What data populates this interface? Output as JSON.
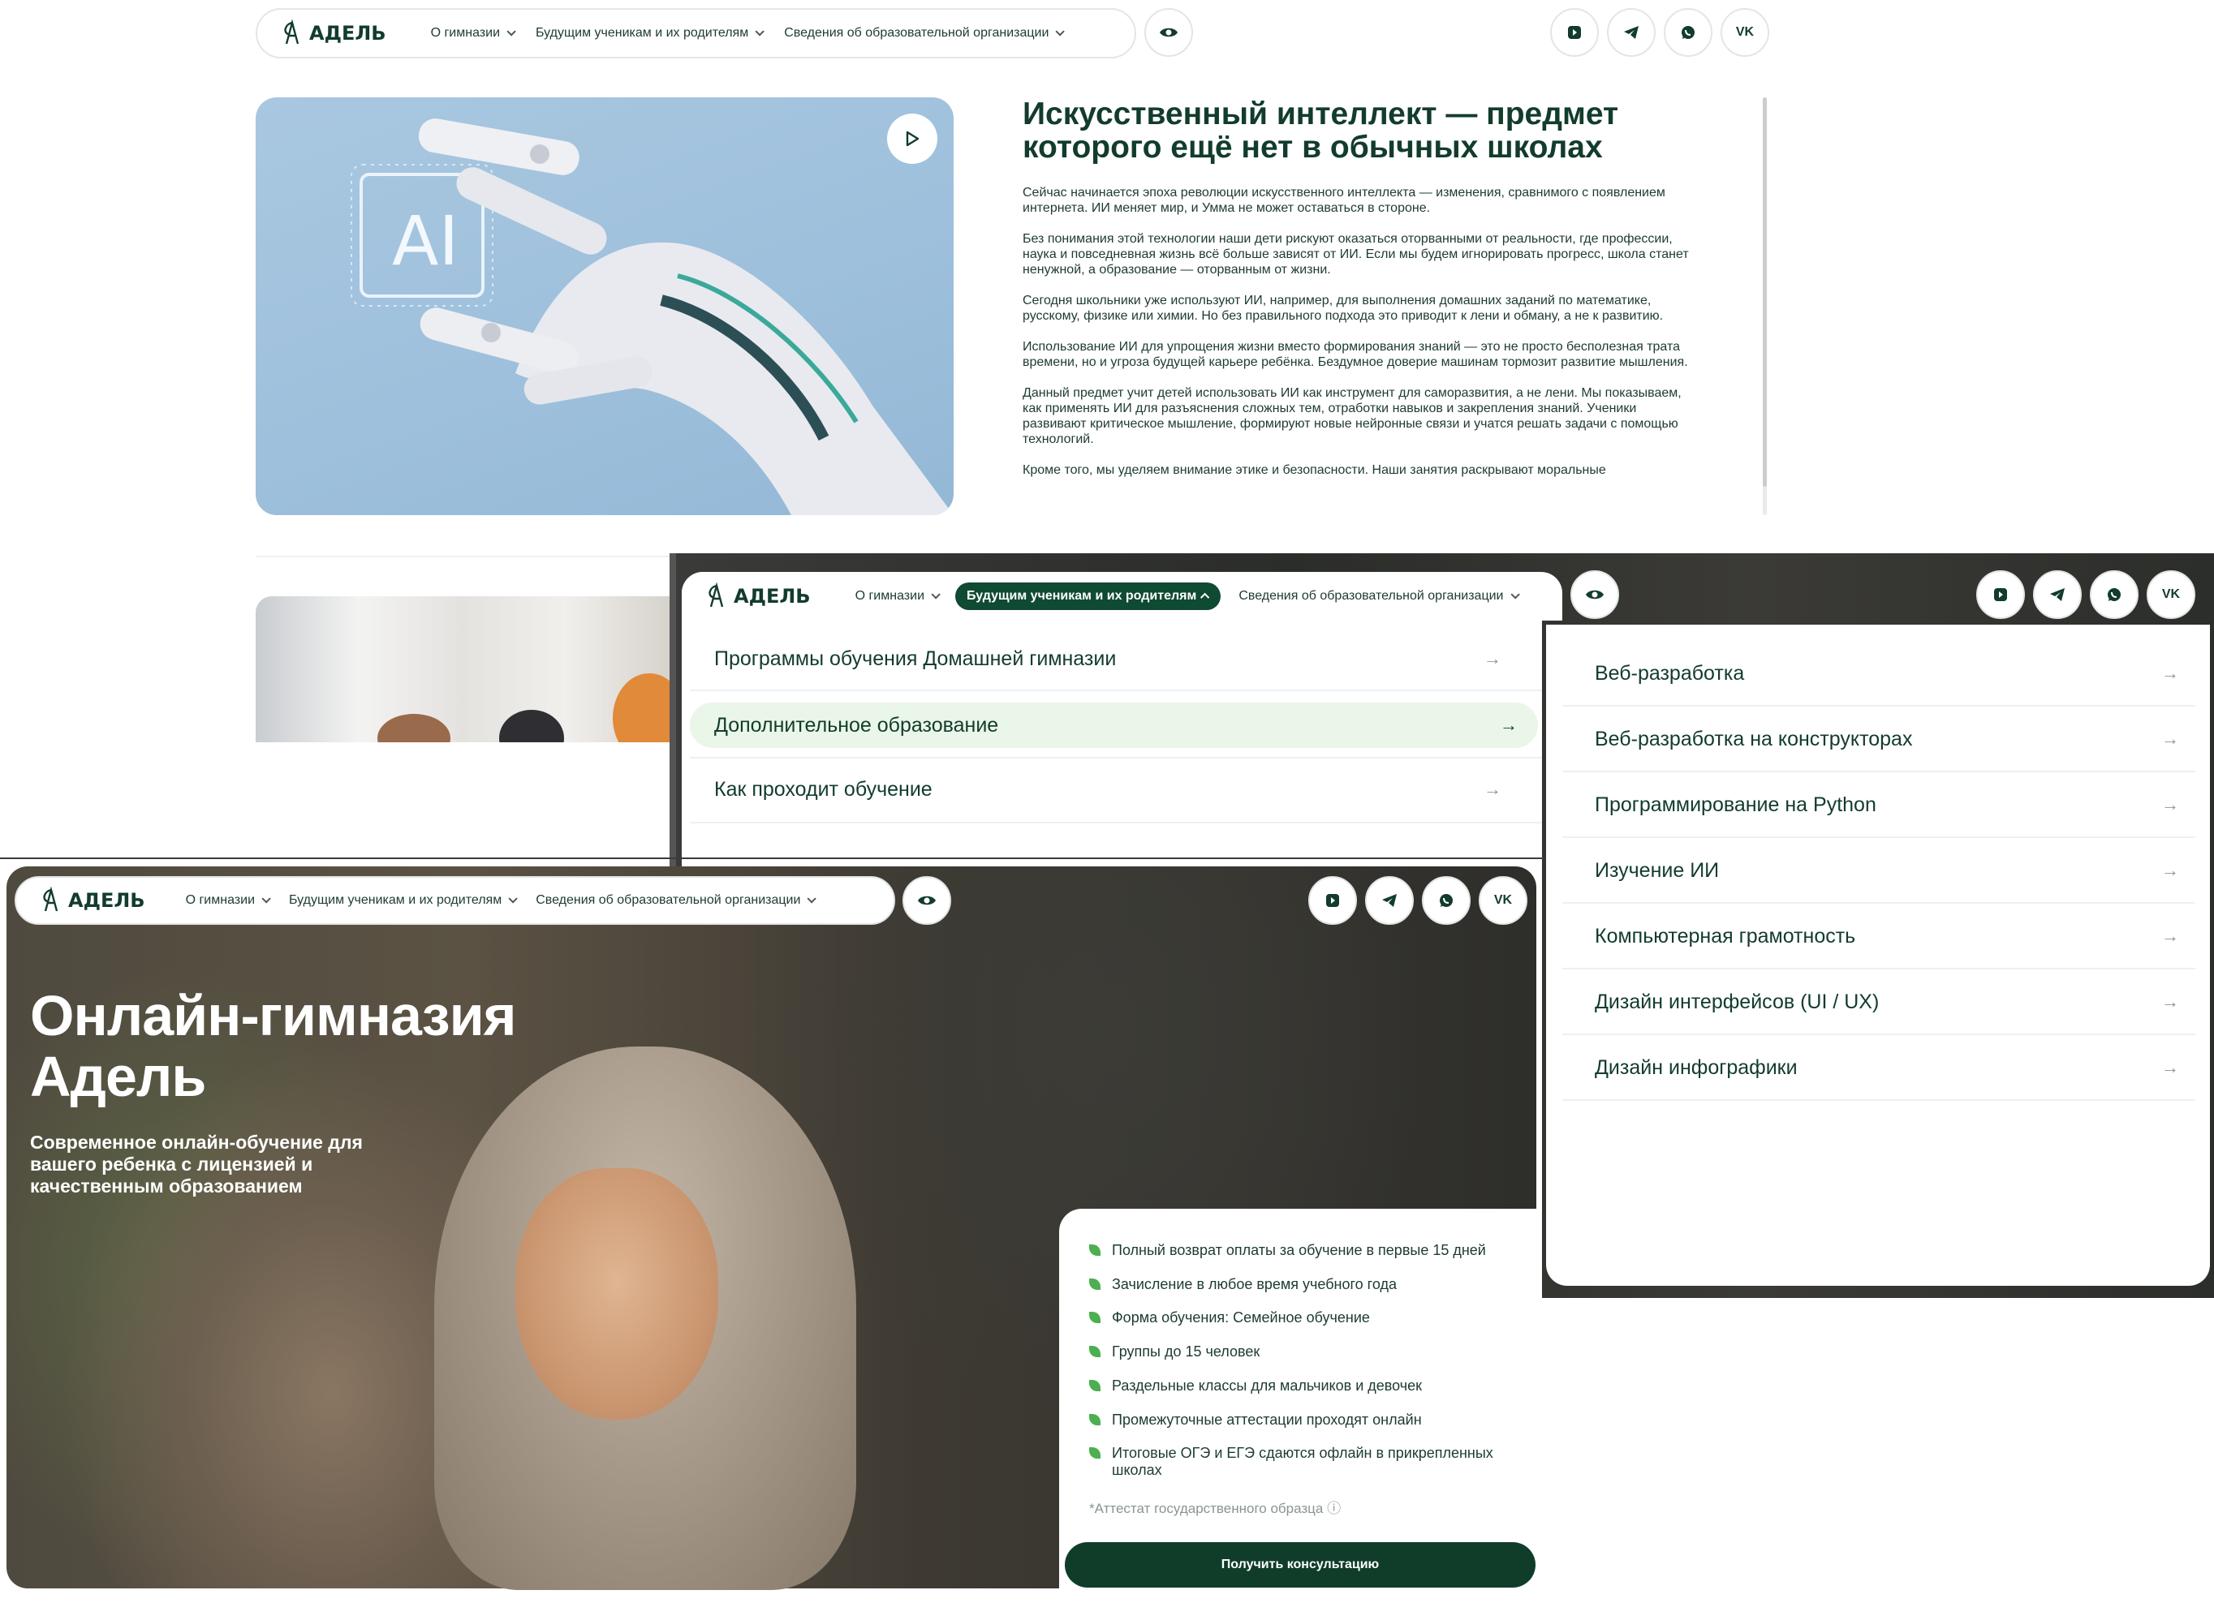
{
  "brand": {
    "logo_text": "АДЕЛЬ"
  },
  "nav": {
    "about": "О гимназии",
    "future": "Будущим ученикам и их родителям",
    "info": "Сведения об образовательной организации"
  },
  "icons": {
    "accessibility": "eye-icon",
    "rutube": "rutube-icon",
    "telegram": "telegram-icon",
    "whatsapp": "whatsapp-icon",
    "vk": "vk-icon",
    "vk_text": "VK"
  },
  "article": {
    "image_text": "AI",
    "title": "Искусственный интеллект — предмет которого ещё нет в обычных школах",
    "paragraphs": [
      "Сейчас начинается эпоха революции искусственного интеллекта — изменения, сравнимого с появлением интернета. ИИ меняет мир, и Умма не может оставаться в стороне.",
      "Без понимания этой технологии наши дети рискуют оказаться оторванными от реальности, где профессии, наука и повседневная жизнь всё больше зависят от ИИ. Если мы будем игнорировать прогресс, школа станет ненужной, а образование — оторванным от жизни.",
      "Сегодня школьники уже используют ИИ, например, для выполнения домашних заданий по математике, русскому, физике или химии. Но без правильного подхода это приводит к лени и обману, а не к развитию.",
      "Использование ИИ для упрощения жизни вместо формирования знаний — это не просто бесполезная трата времени, но и угроза будущей карьере ребёнка. Бездумное доверие машинам тормозит развитие мышления.",
      "Данный предмет учит детей использовать ИИ как инструмент для саморазвития, а не лени. Мы показываем, как применять ИИ для разъяснения сложных тем, отработки навыков и закрепления знаний. Ученики развивают критическое мышление, формируют новые нейронные связи и учатся решать задачи с помощью технологий.",
      "Кроме того, мы уделяем внимание этике и безопасности. Наши занятия раскрывают моральные"
    ]
  },
  "menu": {
    "left": [
      {
        "label": "Программы обучения Домашней гимназии"
      },
      {
        "label": "Дополнительное образование"
      },
      {
        "label": "Как проходит обучение"
      }
    ],
    "right": [
      {
        "label": "Веб-разработка"
      },
      {
        "label": "Веб-разработка на конструкторах"
      },
      {
        "label": "Программирование на Python"
      },
      {
        "label": "Изучение ИИ"
      },
      {
        "label": "Компьютерная грамотность"
      },
      {
        "label": "Дизайн интерфейсов (UI / UX)"
      },
      {
        "label": "Дизайн инфографики"
      }
    ],
    "arrow": "→"
  },
  "hero": {
    "title_line1": "Онлайн-гимназия",
    "title_line2": "Адель",
    "subtitle": "Современное онлайн-обучение для вашего ребенка с лицензией и качественным образованием",
    "features": [
      "Полный возврат оплаты за обучение в первые 15 дней",
      "Зачисление в любое время учебного года",
      "Форма обучения: Семейное обучение",
      "Группы до 15 человек",
      "Раздельные классы для мальчиков и девочек",
      "Промежуточные аттестации проходят онлайн",
      "Итоговые ОГЭ и ЕГЭ сдаются офлайн в прикрепленных школах"
    ],
    "note": "*Аттестат государственного образца ⓘ",
    "cta": "Получить консультацию"
  },
  "colors": {
    "brand_dark": "#0f3d2a",
    "accent_green": "#4caf50",
    "active_bg": "#eaf6e8"
  }
}
